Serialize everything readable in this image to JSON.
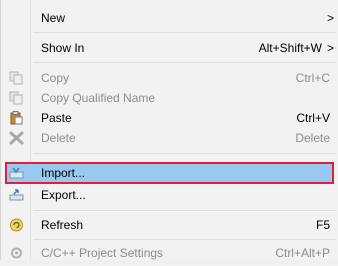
{
  "menu": {
    "items": [
      {
        "label": "New",
        "shortcut": "",
        "submenu_arrow": ">"
      },
      {
        "label": "Show In",
        "shortcut": "Alt+Shift+W",
        "submenu_arrow": ">"
      },
      {
        "label": "Copy",
        "shortcut": "Ctrl+C",
        "disabled": true,
        "icon": "copy-icon"
      },
      {
        "label": "Copy Qualified Name",
        "shortcut": "",
        "disabled": true,
        "icon": "copy-qualified-name-icon"
      },
      {
        "label": "Paste",
        "shortcut": "Ctrl+V",
        "disabled": false,
        "icon": "paste-icon"
      },
      {
        "label": "Delete",
        "shortcut": "Delete",
        "disabled": true,
        "icon": "delete-icon"
      },
      {
        "label": "Import...",
        "shortcut": "",
        "highlighted": true,
        "icon": "import-icon"
      },
      {
        "label": "Export...",
        "shortcut": "",
        "icon": "export-icon"
      },
      {
        "label": "Refresh",
        "shortcut": "F5",
        "icon": "refresh-icon"
      },
      {
        "label": "C/C++ Project Settings",
        "shortcut": "Ctrl+Alt+P",
        "disabled": true,
        "icon": "project-settings-icon"
      }
    ]
  },
  "colors": {
    "highlight_bg": "#99c9ef",
    "highlight_border": "#e0203a",
    "disabled_text": "#8c8c8c"
  }
}
